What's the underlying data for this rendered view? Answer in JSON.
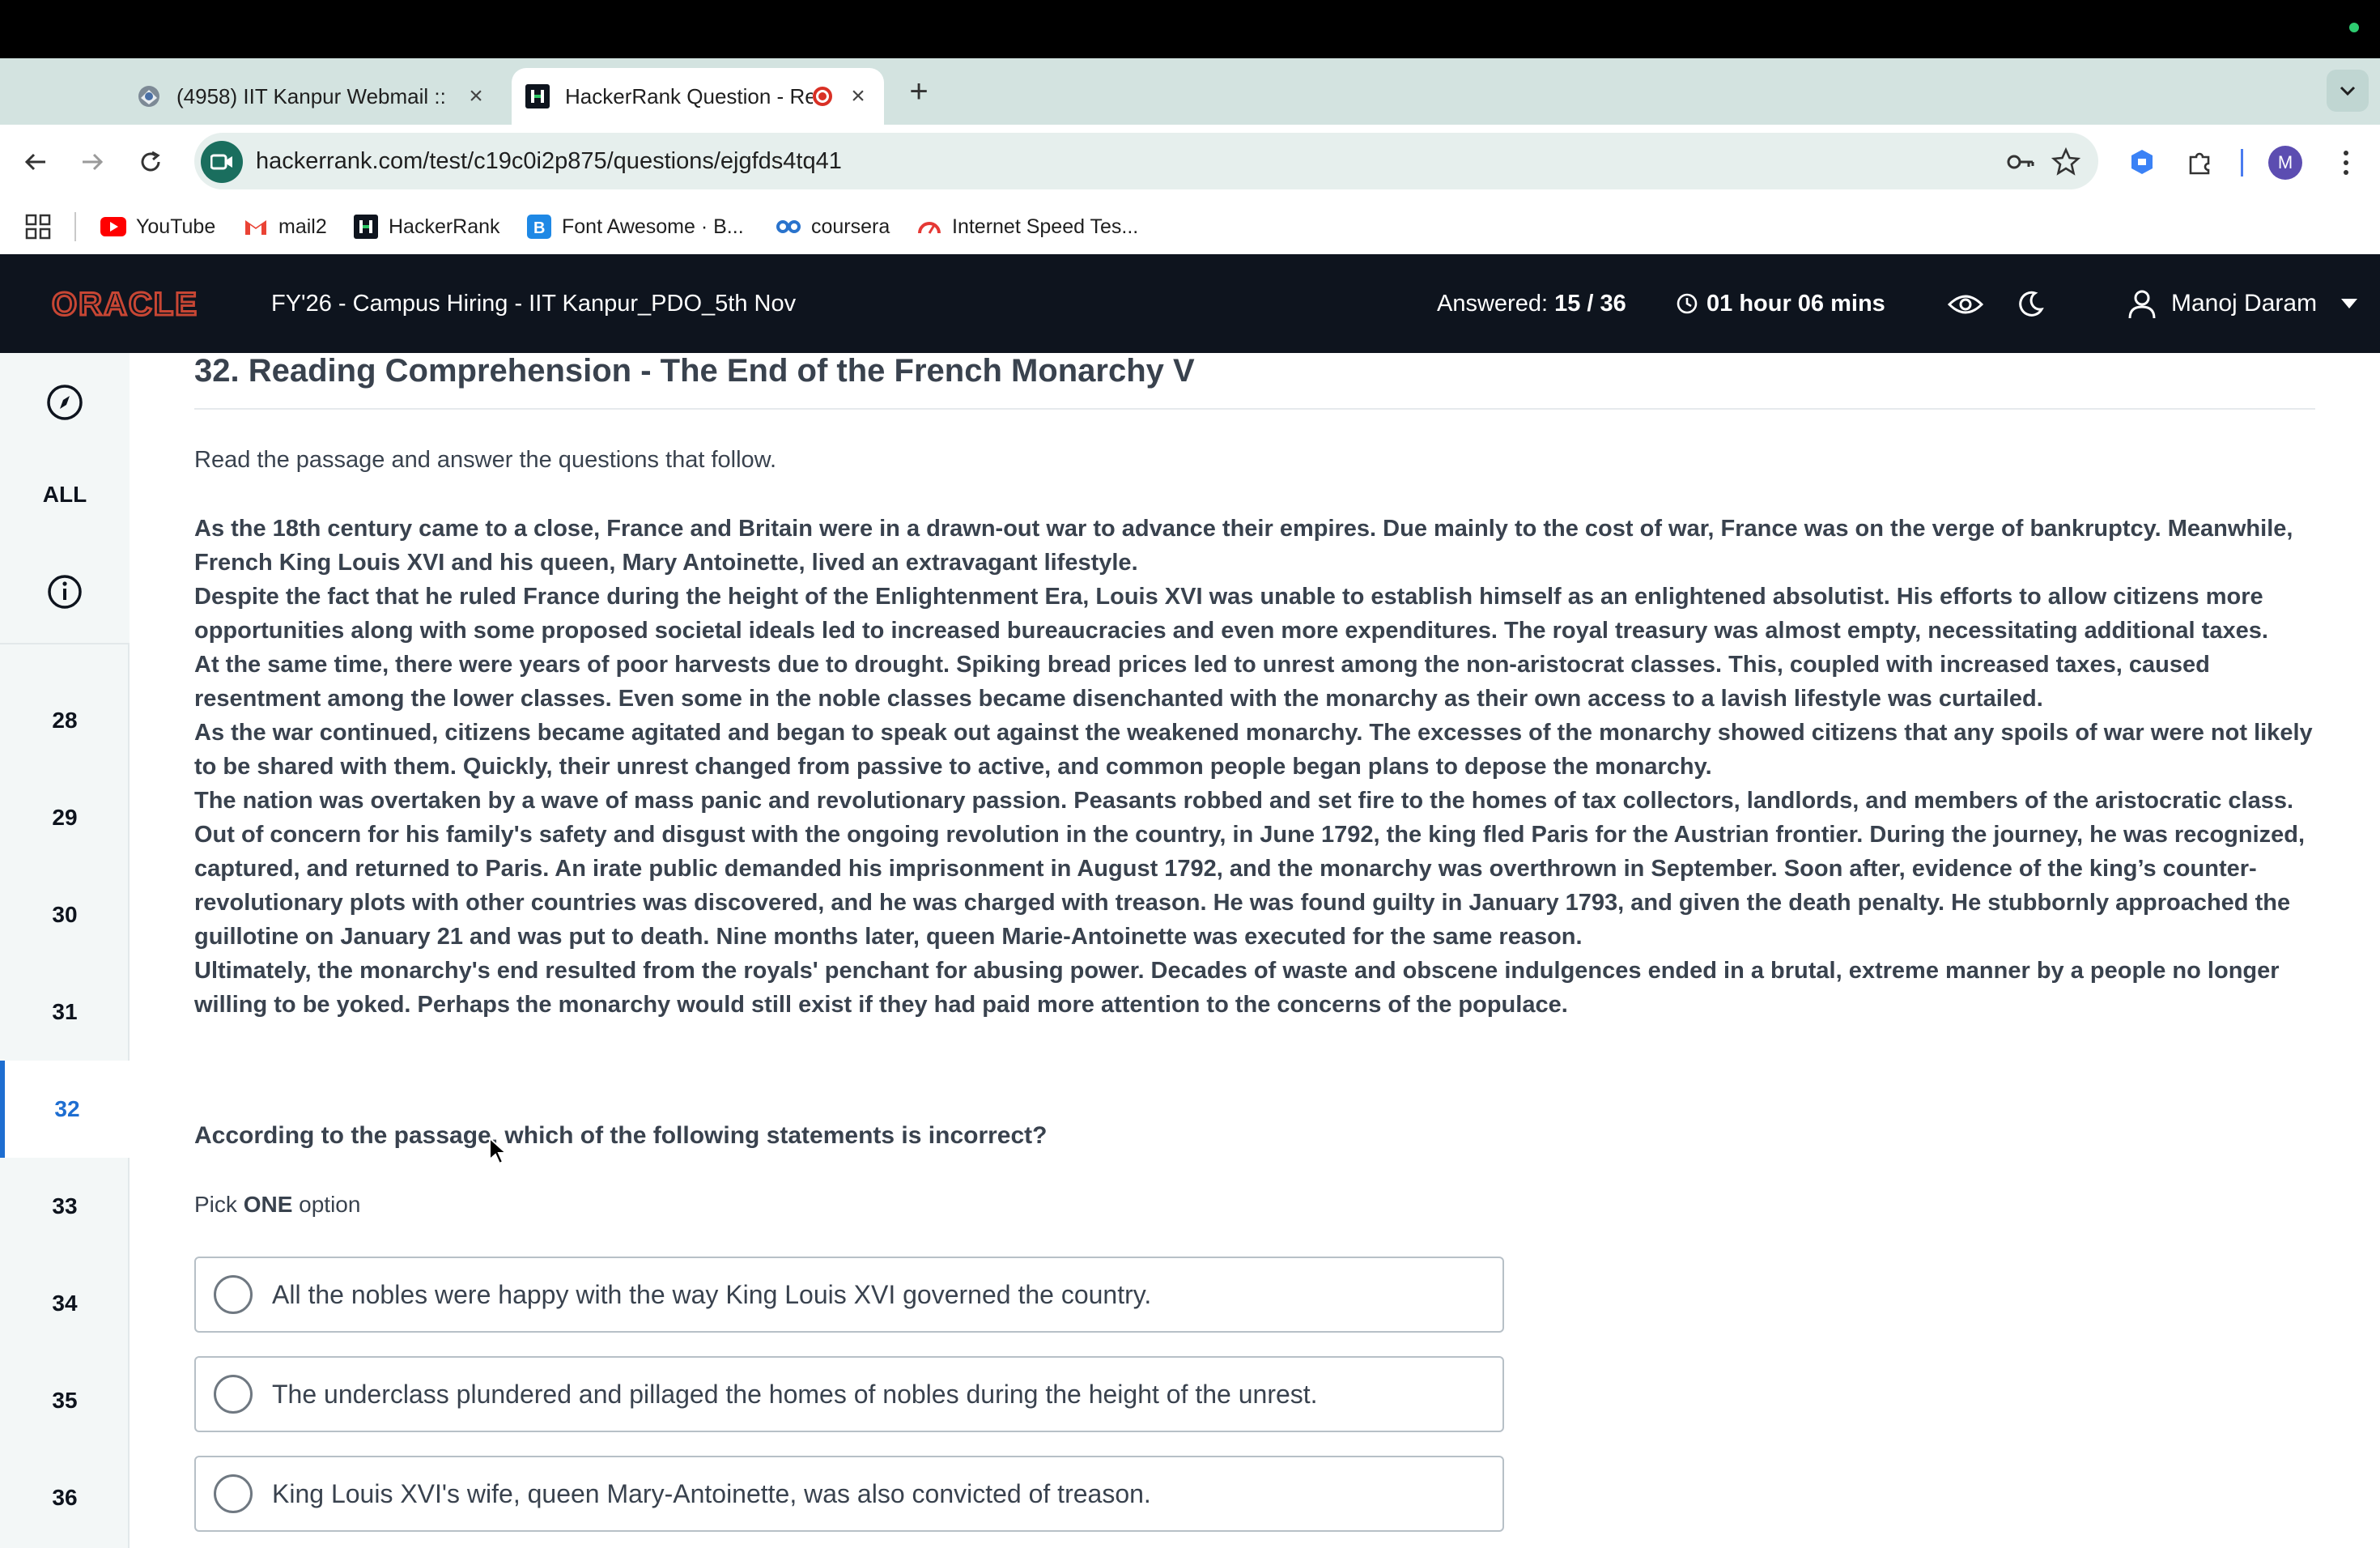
{
  "browser": {
    "tabs": [
      {
        "title": "(4958) IIT Kanpur Webmail ::",
        "close": "×"
      },
      {
        "title": "HackerRank Question - Re",
        "close": "×"
      }
    ],
    "new_tab": "+",
    "url": "hackerrank.com/test/c19c0i2p875/questions/ejgfds4tq41",
    "profile_initial": "M",
    "bookmarks": [
      {
        "label": "YouTube"
      },
      {
        "label": "mail2"
      },
      {
        "label": "HackerRank"
      },
      {
        "label": "Font Awesome · B..."
      },
      {
        "label": "coursera"
      },
      {
        "label": "Internet Speed Tes..."
      }
    ]
  },
  "header": {
    "test_title": "FY'26 - Campus Hiring - IIT Kanpur_PDO_5th Nov",
    "answered_label": "Answered:",
    "answered_value": "15 / 36",
    "timer": "01 hour 06 mins",
    "user_name": "Manoj Daram",
    "brand_color": "#C74634",
    "header_bg": "#0E141E"
  },
  "sidebar": {
    "all_label": "ALL",
    "questions": [
      "28",
      "29",
      "30",
      "31",
      "32",
      "33",
      "34",
      "35",
      "36"
    ],
    "active": "32",
    "accent": "#1E6ED1"
  },
  "question": {
    "title": "32. Reading Comprehension - The End of the French Monarchy V",
    "instructions": "Read the passage and answer the questions that follow.",
    "passage": [
      "As the 18th century came to a close, France and Britain were in a drawn-out war to advance their empires. Due mainly to the cost of war, France was on the verge of bankruptcy. Meanwhile, French King Louis XVI and his queen, Mary Antoinette, lived an extravagant lifestyle.",
      "Despite the fact that he ruled France during the height of the Enlightenment Era, Louis XVI was unable to establish himself as an enlightened absolutist. His efforts to allow citizens more opportunities along with some proposed societal ideals led to increased bureaucracies and even more expenditures.  The royal treasury was almost empty, necessitating additional taxes.",
      "At the same time, there were years of poor harvests due to drought. Spiking bread prices led to unrest among the non-aristocrat classes. This, coupled with increased taxes, caused resentment among the lower classes. Even some in the noble classes became disenchanted with the monarchy as their own access to a lavish lifestyle was curtailed.",
      "As the war continued, citizens became agitated and began to speak out against the weakened monarchy. The excesses of the monarchy showed citizens that any spoils of war were not likely to be shared with them. Quickly, their unrest changed from passive to active, and common people began plans to depose the monarchy.",
      "The nation was overtaken by a wave of mass panic and revolutionary passion. Peasants robbed and set fire to the homes of tax collectors, landlords, and members of the aristocratic class. Out of concern for his family's safety and disgust with the ongoing revolution in the country, in June 1792, the king fled Paris for the Austrian frontier. During the journey, he was recognized, captured, and returned to Paris. An irate public demanded his imprisonment in August 1792, and the monarchy was overthrown in September. Soon after, evidence of the king’s counter-revolutionary plots with other countries was discovered, and he was charged with treason. He was found guilty in January 1793, and given the death penalty. He stubbornly approached the guillotine on January 21 and was put to death. Nine months later, queen Marie-Antoinette was executed for the same reason.",
      "Ultimately, the monarchy's end resulted from the royals' penchant for abusing power. Decades of waste and obscene indulgences ended in a brutal, extreme manner by a people no longer willing to be yoked. Perhaps the monarchy would still exist if they had paid more attention to the concerns of the populace."
    ],
    "prompt": "According to the passage, which of the following statements is incorrect?",
    "pick_prefix": "Pick",
    "pick_strong": "ONE",
    "pick_suffix": "option",
    "options": [
      "All the nobles were happy with the way King Louis XVI governed the country.",
      "The underclass plundered and pillaged the homes of nobles during the height of the unrest.",
      "King Louis XVI's wife, queen Mary-Antoinette, was also convicted of treason."
    ]
  }
}
